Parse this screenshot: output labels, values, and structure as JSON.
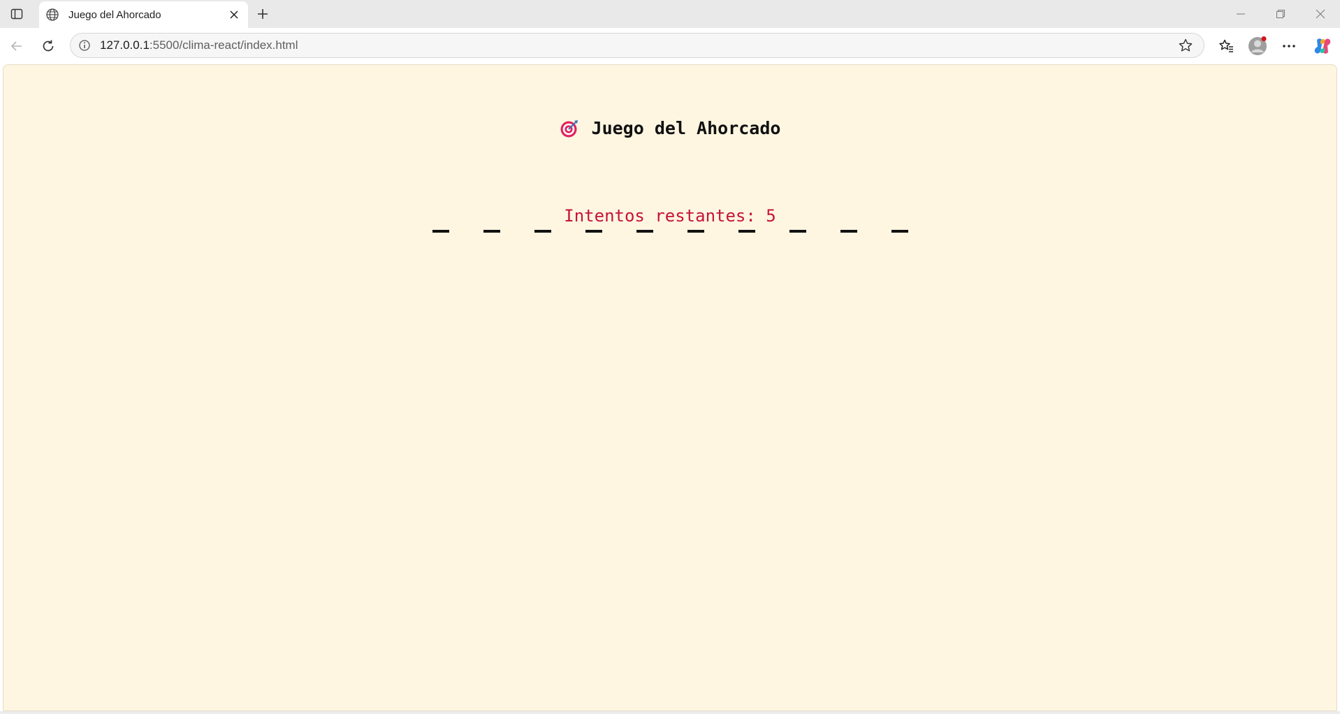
{
  "browser": {
    "tab": {
      "title": "Juego del Ahorcado",
      "icon": "globe-icon"
    },
    "address_bar": {
      "url_host": "127.0.0.1",
      "url_path": ":5500/clima-react/index.html"
    }
  },
  "game": {
    "title": "Juego del Ahorcado",
    "title_icon": "target-icon",
    "word_slots": [
      "_",
      "_",
      "_",
      "_",
      "_",
      "_",
      "_",
      "_",
      "_",
      "_"
    ],
    "attempts_text": "Intentos restantes: 5",
    "attempts_remaining": 5
  },
  "colors": {
    "page_background": "#fef6e1",
    "attempts_text": "#c7123a",
    "title_text": "#111111"
  }
}
